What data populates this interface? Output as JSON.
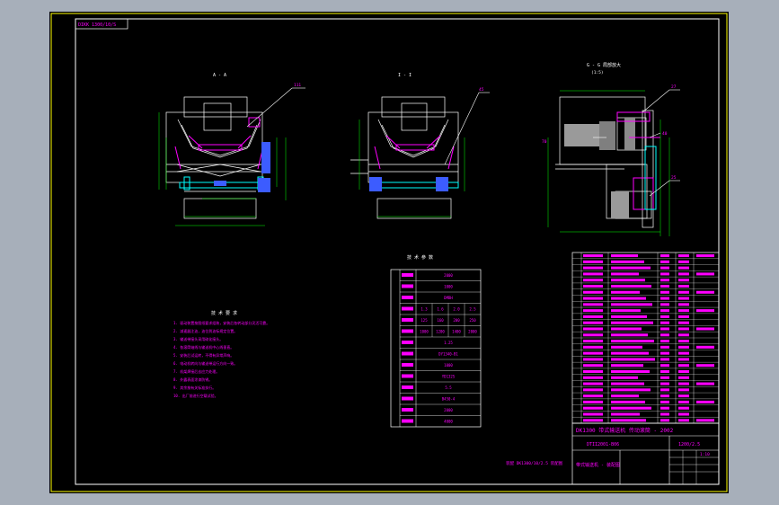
{
  "drawing": {
    "corner_tag": "DIKK 1300/10/S",
    "views": [
      {
        "title": "A - A"
      },
      {
        "title": "I - I"
      },
      {
        "title": "G - G 局部放大",
        "subtitle": "(1:5)"
      }
    ],
    "callouts": [
      "111",
      "45",
      "27",
      "40",
      "25",
      "70"
    ],
    "tech_table": {
      "title": "技 术 参 数",
      "rows": [
        [
          "2000",
          "",
          ""
        ],
        [
          "1000",
          "",
          ""
        ],
        [
          "DMBH",
          "",
          ""
        ],
        [
          "1.3",
          "1.6",
          "2.0",
          "2.5"
        ],
        [
          "125",
          "160",
          "200",
          "250"
        ],
        [
          "1000",
          "1200",
          "1400",
          "2000"
        ],
        [
          "1.25",
          "",
          ""
        ],
        [
          "DY1340-B1",
          "",
          ""
        ],
        [
          "1000",
          "",
          ""
        ],
        [
          "YD132S",
          "",
          ""
        ],
        [
          "5.5",
          "",
          ""
        ],
        [
          "B450-4",
          "",
          ""
        ],
        [
          "2000",
          "",
          ""
        ],
        [
          "4000",
          "",
          ""
        ]
      ]
    },
    "notes": {
      "title": "技 术 要 求",
      "lines": [
        "1. 驱动装置按图纸要求组装，安装后各转动部分灵活可靠。",
        "2. 减速器注油，油位到油标规定位置。",
        "3. 输送带接头采用硫化接头。",
        "4. 各滚筒轴线与输送机中心线垂直。",
        "5. 安装后试运转，不得有异常声响。",
        "6. 电动机转向与输送带运行方向一致。",
        "7. 机架焊接后去应力处理。",
        "8. 外露表面涂漆防锈。",
        "9. 其余按有关标准执行。",
        "10. 出厂前进行空载试验。"
      ]
    },
    "part_count": 28,
    "title_block": {
      "company": "DK1300 带式输送机 传动滚筒 - 2002",
      "drawing_no": "DTII2001-B06",
      "material_code": "1200/2.5",
      "footer_left": "带式输送机 - 装配图",
      "scale": "1:10"
    },
    "caption": "装配 DK1300/10/2.5 装配图"
  },
  "colors": {
    "background": "#000000",
    "chrome": "#a7afba",
    "lines": "#ffffff",
    "border": "#ffff00",
    "annotation": "#ff00ff",
    "dimension": "#00ff00",
    "motor": "#aaaaaa",
    "accent": "#3c5cff"
  }
}
